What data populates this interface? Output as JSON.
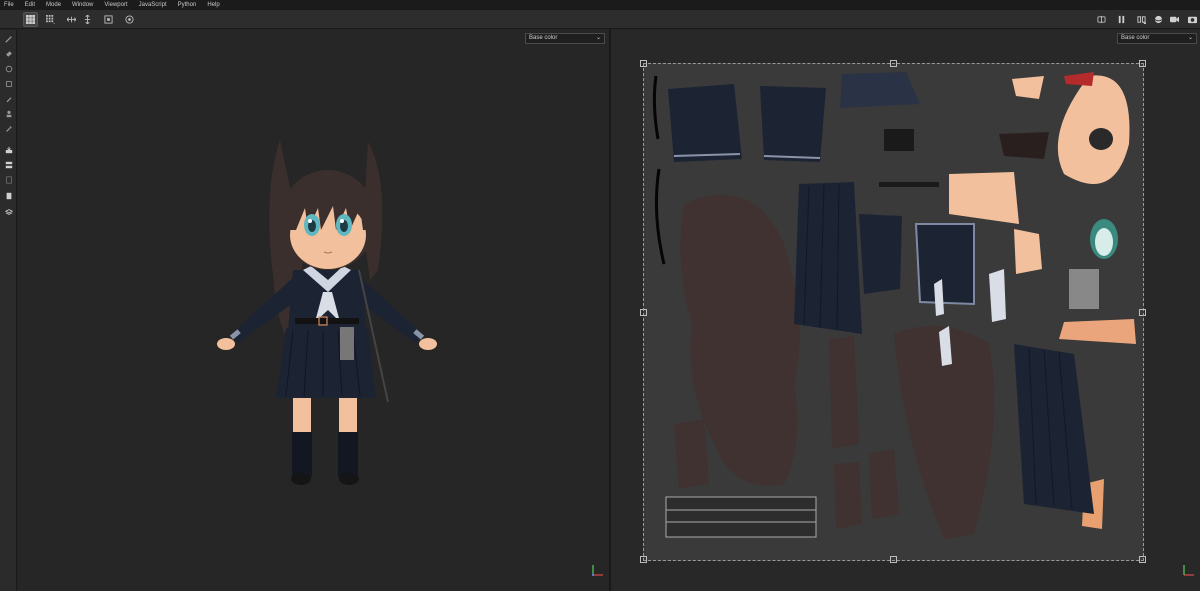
{
  "menu": [
    "File",
    "Edit",
    "Mode",
    "Window",
    "Viewport",
    "JavaScript",
    "Python",
    "Help"
  ],
  "toolbar": {
    "left_icons": [
      "single-view-icon",
      "grid-view-icon",
      "fit-horizontal-icon",
      "fit-vertical-icon",
      "frame-icon",
      "target-icon"
    ],
    "right_icons": [
      "symmetry-icon",
      "pause-icon",
      "compare-icon",
      "sphere-icon",
      "camera-icon",
      "screenshot-icon"
    ]
  },
  "tools": [
    "paint-brush-icon",
    "eraser-icon",
    "projection-icon",
    "geometry-mask-icon",
    "smudge-icon",
    "clone-stamp-icon",
    "color-picker-icon",
    "bake-icon",
    "fill-icon",
    "polygon-fill-icon",
    "history-icon",
    "layers-icon",
    "material-icon"
  ],
  "viewport3d": {
    "channel": "Base color"
  },
  "viewport2d": {
    "channel": "Base color"
  },
  "colors": {
    "bg": "#242424",
    "panel": "#2d2d2d",
    "uv_bg": "#3a3a3a",
    "hair": "#3b2f2e",
    "skin": "#f2c09c",
    "uniform": "#1c2333"
  }
}
